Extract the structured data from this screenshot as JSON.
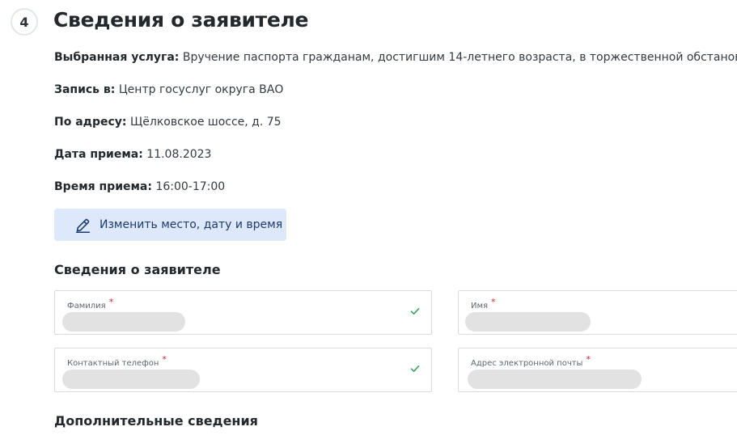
{
  "step": {
    "number": "4",
    "title": "Сведения о заявителе"
  },
  "info": {
    "service_label": "Выбранная услуга:",
    "service_value": "Вручение паспорта гражданам, достигшим 14-летнего возраста, в торжественной обстановке",
    "place_label": "Запись в:",
    "place_value": "Центр госуслуг округа ВАО",
    "address_label": "По адресу:",
    "address_value": "Щёлковское шоссе, д. 75",
    "date_label": "Дата приема:",
    "date_value": "11.08.2023",
    "time_label": "Время приема:",
    "time_value": "16:00-17:00"
  },
  "change_button": {
    "label": "Изменить место, дату и время"
  },
  "applicant_section": {
    "title": "Сведения о заявителе"
  },
  "fields": {
    "surname": {
      "label": "Фамилия",
      "required": "*"
    },
    "name": {
      "label": "Имя",
      "required": "*"
    },
    "phone": {
      "label": "Контактный телефон",
      "required": "*"
    },
    "email": {
      "label": "Адрес электронной почты",
      "required": "*"
    }
  },
  "additional_section": {
    "title": "Дополнительные сведения"
  },
  "colors": {
    "accent_button_bg": "#dde9fa",
    "accent_button_text": "#1d3a6b",
    "required_mark": "#d2232a",
    "valid_check": "#3aa35c"
  },
  "icons": {
    "change_button": "pencil-icon",
    "valid_field": "check-icon"
  }
}
